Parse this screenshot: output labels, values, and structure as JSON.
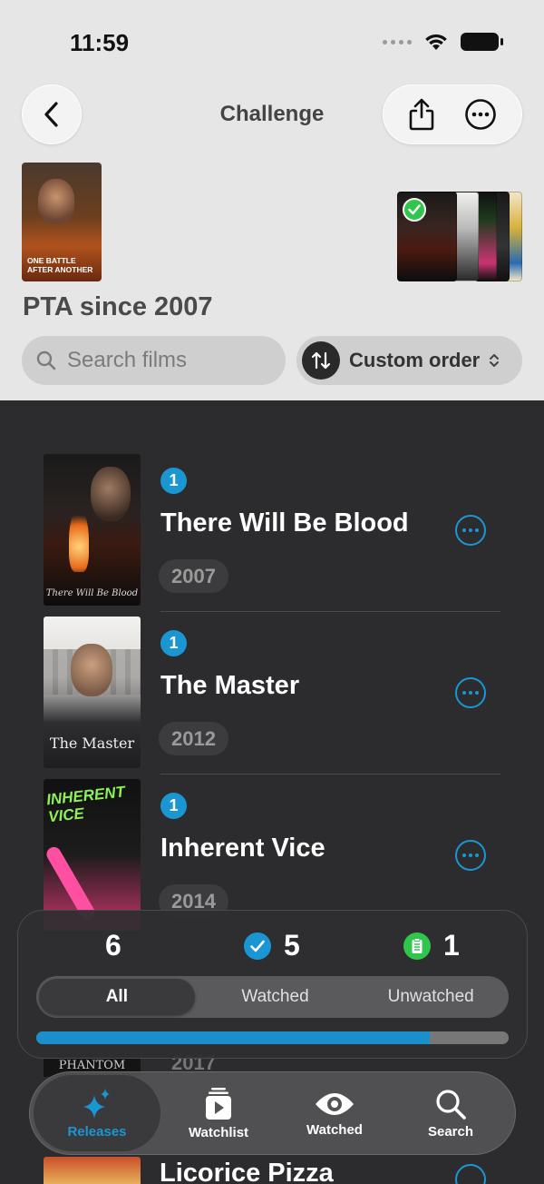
{
  "status_bar": {
    "time": "11:59"
  },
  "nav": {
    "title": "Challenge"
  },
  "list": {
    "title": "PTA since 2007",
    "hero_poster_text": "ONE BATTLE AFTER ANOTHER"
  },
  "search": {
    "placeholder": "Search films"
  },
  "sort": {
    "label": "Custom order"
  },
  "films": [
    {
      "rank": "1",
      "title": "There Will Be Blood",
      "year": "2007",
      "poster_text": "There Will Be Blood"
    },
    {
      "rank": "1",
      "title": "The Master",
      "year": "2012",
      "poster_text": "The Master"
    },
    {
      "rank": "1",
      "title": "Inherent Vice",
      "year": "2014",
      "poster_text": "INHERENT VICE"
    }
  ],
  "peek": {
    "year": "2017",
    "poster_text": "PHANTOM",
    "next_title": "Licorice Pizza"
  },
  "stats": {
    "total": "6",
    "watched": "5",
    "unwatched": "1",
    "progress_fraction": 0.833
  },
  "filter": {
    "all": "All",
    "watched": "Watched",
    "unwatched": "Unwatched",
    "selected": "All"
  },
  "tabbar": {
    "releases": "Releases",
    "watchlist": "Watchlist",
    "watched": "Watched",
    "search": "Search",
    "active": "Releases"
  },
  "colors": {
    "accent": "#1a97d3",
    "check": "#30c64b"
  }
}
